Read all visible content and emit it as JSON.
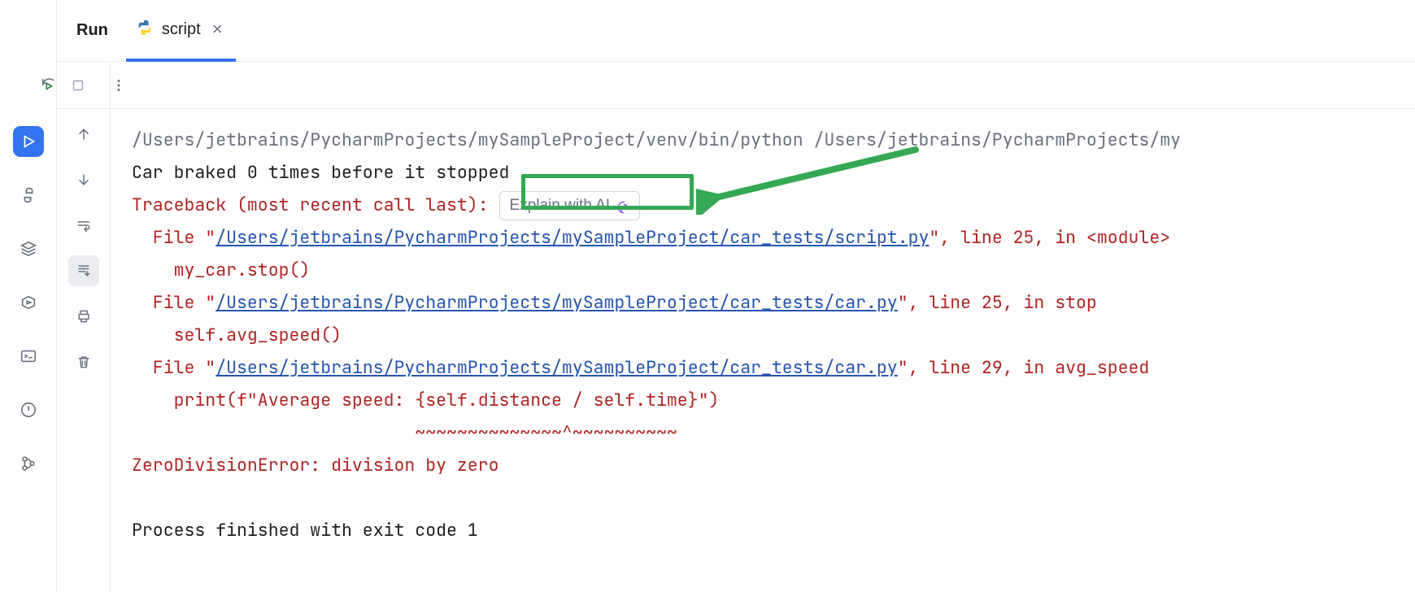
{
  "tabs": {
    "run_label": "Run",
    "script_name": "script"
  },
  "ai_button": {
    "label": "Explain with AI"
  },
  "console": {
    "command": "/Users/jetbrains/PycharmProjects/mySampleProject/venv/bin/python /Users/jetbrains/PycharmProjects/my",
    "output_line": "Car braked 0 times before it stopped",
    "traceback_header_pre": "Traceback (most recent call last):",
    "frames": [
      {
        "prefix": "  File \"",
        "path": "/Users/jetbrains/PycharmProjects/mySampleProject/car_tests/script.py",
        "suffix": "\", line 25, in <module>",
        "code": "    my_car.stop()"
      },
      {
        "prefix": "  File \"",
        "path": "/Users/jetbrains/PycharmProjects/mySampleProject/car_tests/car.py",
        "suffix": "\", line 25, in stop",
        "code": "    self.avg_speed()"
      },
      {
        "prefix": "  File \"",
        "path": "/Users/jetbrains/PycharmProjects/mySampleProject/car_tests/car.py",
        "suffix": "\", line 29, in avg_speed",
        "code": "    print(f\"Average speed: {self.distance / self.time}\")"
      }
    ],
    "marker": "                           ~~~~~~~~~~~~~~^~~~~~~~~~~",
    "error": "ZeroDivisionError: division by zero",
    "exit": "Process finished with exit code 1"
  }
}
